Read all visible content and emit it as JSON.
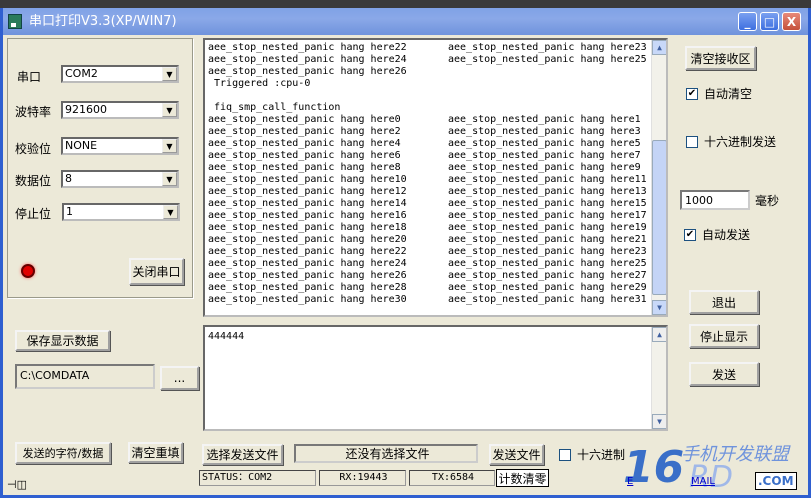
{
  "window": {
    "title": "串口打印V3.3(XP/WIN7)",
    "minimize": "_",
    "maximize": "□",
    "close": "X"
  },
  "settings": {
    "port": {
      "label": "串口",
      "value": "COM2"
    },
    "baud": {
      "label": "波特率",
      "value": "921600"
    },
    "parity": {
      "label": "校验位",
      "value": "NONE"
    },
    "databits": {
      "label": "数据位",
      "value": "8"
    },
    "stopbits": {
      "label": "停止位",
      "value": "1"
    },
    "close_port": "关闭串口",
    "led_color": "#e00000"
  },
  "save": {
    "button": "保存显示数据",
    "path": "C:\\COMDATA",
    "browse": "..."
  },
  "receive": {
    "rows": [
      [
        "aee_stop_nested_panic hang here22",
        "aee_stop_nested_panic hang here23"
      ],
      [
        "aee_stop_nested_panic hang here24",
        "aee_stop_nested_panic hang here25"
      ],
      [
        "aee_stop_nested_panic hang here26",
        ""
      ],
      [
        " Triggered :cpu-0",
        ""
      ],
      [
        "",
        ""
      ],
      [
        " fiq_smp_call_function",
        ""
      ],
      [
        "aee_stop_nested_panic hang here0",
        "aee_stop_nested_panic hang here1"
      ],
      [
        "aee_stop_nested_panic hang here2",
        "aee_stop_nested_panic hang here3"
      ],
      [
        "aee_stop_nested_panic hang here4",
        "aee_stop_nested_panic hang here5"
      ],
      [
        "aee_stop_nested_panic hang here6",
        "aee_stop_nested_panic hang here7"
      ],
      [
        "aee_stop_nested_panic hang here8",
        "aee_stop_nested_panic hang here9"
      ],
      [
        "aee_stop_nested_panic hang here10",
        "aee_stop_nested_panic hang here11"
      ],
      [
        "aee_stop_nested_panic hang here12",
        "aee_stop_nested_panic hang here13"
      ],
      [
        "aee_stop_nested_panic hang here14",
        "aee_stop_nested_panic hang here15"
      ],
      [
        "aee_stop_nested_panic hang here16",
        "aee_stop_nested_panic hang here17"
      ],
      [
        "aee_stop_nested_panic hang here18",
        "aee_stop_nested_panic hang here19"
      ],
      [
        "aee_stop_nested_panic hang here20",
        "aee_stop_nested_panic hang here21"
      ],
      [
        "aee_stop_nested_panic hang here22",
        "aee_stop_nested_panic hang here23"
      ],
      [
        "aee_stop_nested_panic hang here24",
        "aee_stop_nested_panic hang here25"
      ],
      [
        "aee_stop_nested_panic hang here26",
        "aee_stop_nested_panic hang here27"
      ],
      [
        "aee_stop_nested_panic hang here28",
        "aee_stop_nested_panic hang here29"
      ],
      [
        "aee_stop_nested_panic hang here30",
        "aee_stop_nested_panic hang here31"
      ]
    ]
  },
  "send": {
    "text": "444444"
  },
  "right": {
    "clear_receive": "清空接收区",
    "auto_clear": "自动清空",
    "auto_clear_checked": true,
    "hex_send": "十六进制发送",
    "hex_send_checked": false,
    "interval": "1000",
    "ms": "毫秒",
    "auto_send": "自动发送",
    "auto_send_checked": true,
    "exit": "退出",
    "stop_display": "停止显示",
    "send": "发送"
  },
  "bottom": {
    "sent_data": "发送的字符/数据",
    "clear_refill": "清空重填",
    "choose_file": "选择发送文件",
    "file_status": "还没有选择文件",
    "send_file": "发送文件",
    "hex": "十六进制"
  },
  "status": {
    "port": "STATUS：COM2",
    "rx": "RX:19443",
    "tx": "TX:6584",
    "reset": "计数清零"
  },
  "logo": {
    "number": "16",
    "brand": "RD",
    "suffix": ".COM",
    "tagline": "手机开发联盟",
    "link1": "E",
    "link2": "MAIL"
  },
  "pin": "⊣◫"
}
